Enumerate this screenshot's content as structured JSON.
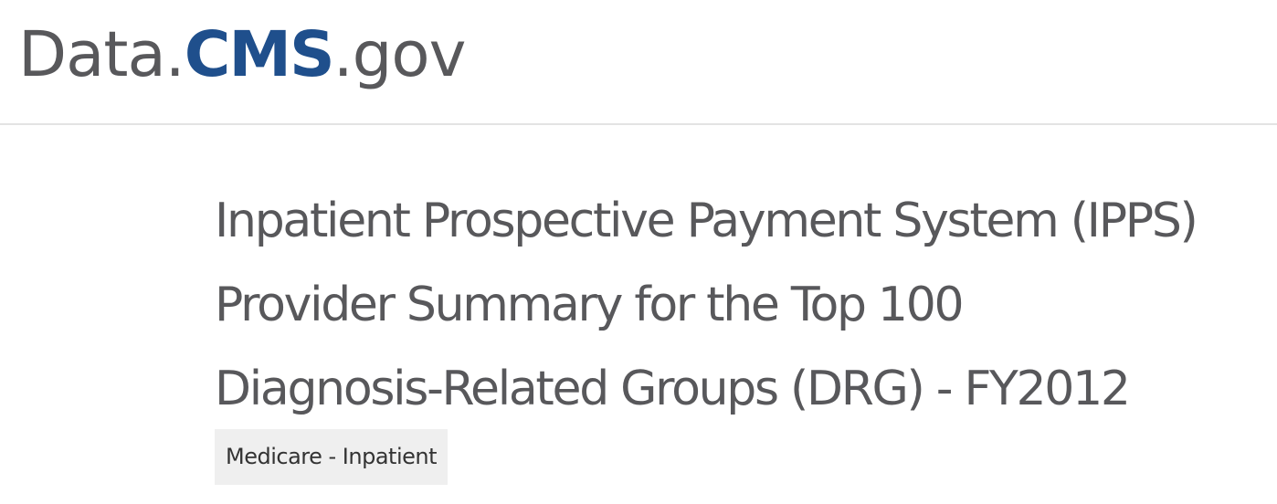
{
  "header": {
    "logo": {
      "part_data": "Data.",
      "part_cms": "CMS",
      "part_gov": ".gov"
    }
  },
  "dataset": {
    "title_lines": [
      "Inpatient Prospective Payment System (IPPS)",
      "Provider Summary for the Top 100",
      "Diagnosis-Related Groups (DRG) - FY2012"
    ],
    "category": "Medicare - Inpatient"
  },
  "colors": {
    "logo_gray": "#58585b",
    "logo_blue": "#1f4f8c",
    "title_text": "#58585b",
    "tag_background": "#efefef",
    "tag_text": "#333333",
    "divider": "#e3e3e3"
  }
}
